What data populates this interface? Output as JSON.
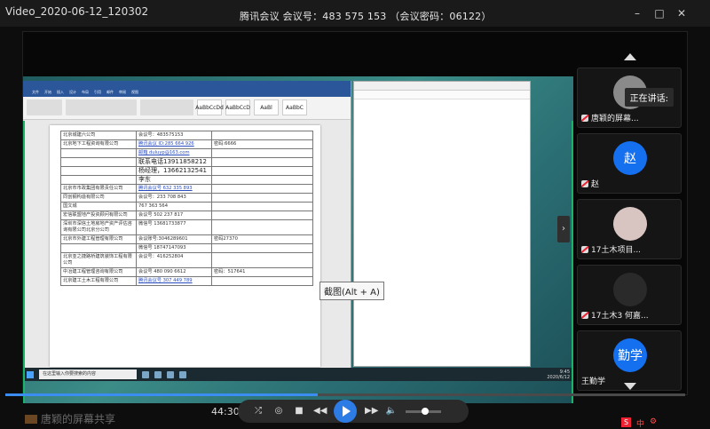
{
  "window": {
    "file_name": "Video_2020-06-12_120302",
    "meeting_title": "腾讯会议 会议号：483 575 153 （会议密码：06122）",
    "controls": [
      "–",
      "□",
      "✕"
    ]
  },
  "word_window": {
    "tabs": [
      "文件",
      "开始",
      "插入",
      "设计",
      "布局",
      "引用",
      "邮件",
      "审阅",
      "视图"
    ],
    "styles": [
      "AaBbCcDd",
      "AaBbCcD",
      "AaBl",
      "AaBbC"
    ]
  },
  "document_table": [
    [
      "北京城建六公司",
      "会议号：483575153",
      ""
    ],
    [
      "北京地下工程资询有限公司",
      "腾讯会议 ID:285 664 926",
      "密码:6666"
    ],
    [
      "",
      "邮箱 duluyp@163.com",
      ""
    ],
    [
      "",
      "联系电话13911858212",
      ""
    ],
    [
      "",
      "杨经理，13662132541",
      ""
    ],
    [
      "",
      "李东",
      ""
    ],
    [
      "北京市市政集团有限责任公司",
      "腾讯会议号 632 335 893",
      ""
    ],
    [
      "同创钢构造有限公司",
      "会议号：233 708 843",
      ""
    ],
    [
      "国文城",
      "767 363 564",
      ""
    ],
    [
      "宏信联盟地产投资顾问有限公司",
      "会议号 502 237 817",
      ""
    ],
    [
      "深圳市深信土地房地产资产评估咨询有限公司北京分公司",
      "微信号 13681733877",
      ""
    ],
    [
      "北京市外建工程管理有限公司",
      "会议账号:3046289601",
      "密码27370"
    ],
    [
      "",
      "微信号 18747147093",
      ""
    ],
    [
      "北京亚之捷路桥建筑装饰工程有限公司",
      "会议号：416252804",
      ""
    ],
    [
      "中冶建工程管理咨询有限公司",
      "会议号 480 090 6612",
      "密码：517641"
    ],
    [
      "北京建工土木工程有限公司",
      "腾讯会议号 307 449 789",
      ""
    ]
  ],
  "taskbar": {
    "search_placeholder": "在这里输入你要搜索的内容",
    "clock_time": "9:45",
    "clock_date": "2020/6/12"
  },
  "tooltip": "截图(Alt + A)",
  "participants": {
    "speaking_label": "正在讲话:",
    "list": [
      {
        "avatar_text": "",
        "name": "唐颖的屏幕...",
        "color": "#8a8a8a"
      },
      {
        "avatar_text": "赵",
        "name": "赵",
        "color": "#1570f0"
      },
      {
        "avatar_text": "",
        "name": "17土木项目...",
        "color": "#d8c5c2"
      },
      {
        "avatar_text": "",
        "name": "17土木3 何嘉...",
        "color": "#2a2a2a"
      },
      {
        "avatar_text": "勤学",
        "name": "王勤学",
        "color": "#1570f0"
      }
    ]
  },
  "player": {
    "time": "44:30",
    "progress": 0.46,
    "volume": 0.55
  },
  "caption": "唐颖的屏幕共享"
}
